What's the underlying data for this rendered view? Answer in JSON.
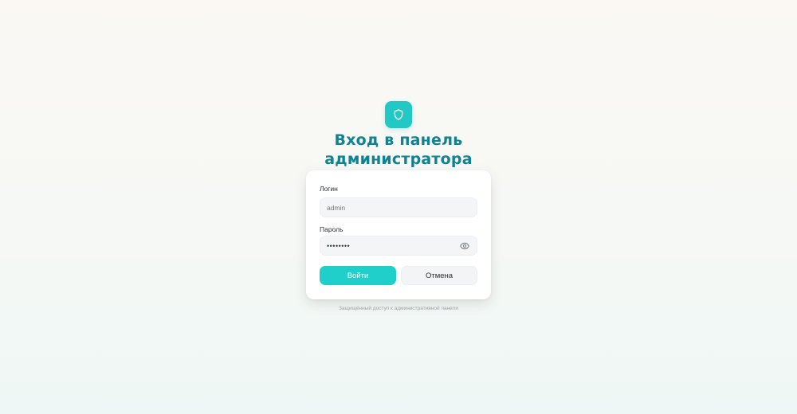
{
  "header": {
    "logo_icon": "shield-icon",
    "title_line1": "Вход в панель",
    "title_line2": "администратора"
  },
  "form": {
    "login_label": "Логин",
    "login_placeholder": "admin",
    "password_label": "Пароль",
    "password_value": "••••••••",
    "password_toggle_icon": "eye-icon",
    "submit_label": "Войти",
    "cancel_label": "Отмена"
  },
  "footer": {
    "text": "Защищённый доступ к административной панели"
  },
  "colors": {
    "accent": "#21cfca",
    "title": "#0f8294"
  }
}
